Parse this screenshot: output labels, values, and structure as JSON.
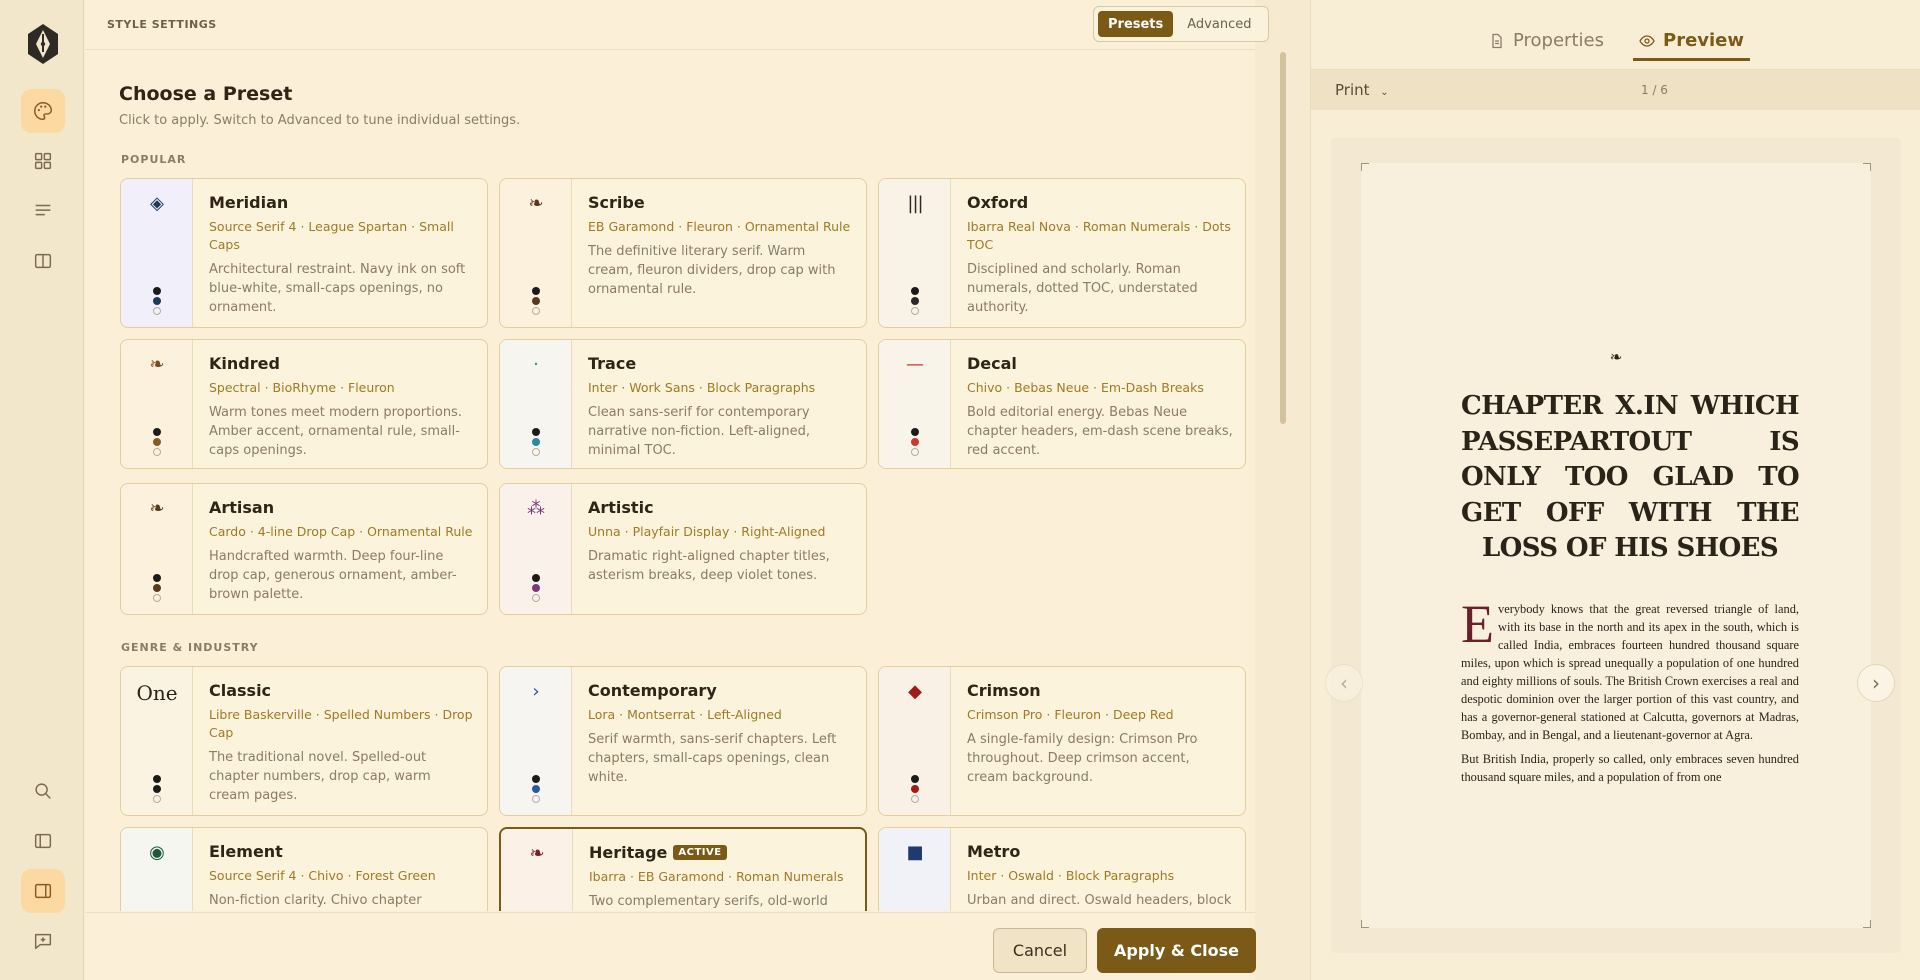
{
  "rail": {
    "items": [
      "logo",
      "palette",
      "grid",
      "lines",
      "book",
      "search",
      "panel-left",
      "panel-right",
      "comment-plus"
    ]
  },
  "header": {
    "title": "STYLE SETTINGS",
    "seg_presets": "Presets",
    "seg_advanced": "Advanced"
  },
  "main": {
    "heading": "Choose a Preset",
    "subheading": "Click to apply. Switch to Advanced to tune individual settings.",
    "section_popular": "POPULAR",
    "section_genre": "GENRE & INDUSTRY"
  },
  "cards": [
    {
      "name": "Meridian",
      "meta": "Source Serif 4 · League Spartan · Small Caps",
      "desc": "Architectural restraint. Navy ink on soft blue-white, small-caps openings, no ornament.",
      "glyph": "◈",
      "glyph_color": "#1e3a5f",
      "bg": "#f1effa",
      "dots": [
        "#1b1b1b",
        "#1e3a5f"
      ]
    },
    {
      "name": "Scribe",
      "meta": "EB Garamond · Fleuron · Ornamental Rule",
      "desc": "The definitive literary serif. Warm cream, fleuron dividers, drop cap with ornamental rule.",
      "glyph": "❧",
      "glyph_color": "#5a3a1e",
      "bg": "#fbf1dc",
      "dots": [
        "#1b1b1b",
        "#5a3a1e"
      ]
    },
    {
      "name": "Oxford",
      "meta": "Ibarra Real Nova · Roman Numerals · Dots TOC",
      "desc": "Disciplined and scholarly. Roman numerals, dotted TOC, understated authority.",
      "glyph": "|||",
      "glyph_color": "#2a2a2a",
      "bg": "#f8f3e6",
      "dots": [
        "#1b1b1b",
        "#2a2a2a"
      ]
    },
    {
      "name": "Kindred",
      "meta": "Spectral · BioRhyme · Fleuron",
      "desc": "Warm tones meet modern proportions. Amber accent, ornamental rule, small-caps openings.",
      "glyph": "❧",
      "glyph_color": "#7a4a1e",
      "bg": "#fbf1dc",
      "dots": [
        "#1b1b1b",
        "#8a5a22"
      ]
    },
    {
      "name": "Trace",
      "meta": "Inter · Work Sans · Block Paragraphs",
      "desc": "Clean sans-serif for contemporary narrative non-fiction. Left-aligned, minimal TOC.",
      "glyph": "·",
      "glyph_color": "#2a8a9a",
      "bg": "#f7f5ef",
      "dots": [
        "#1b1b1b",
        "#2a8a9a"
      ]
    },
    {
      "name": "Decal",
      "meta": "Chivo · Bebas Neue · Em-Dash Breaks",
      "desc": "Bold editorial energy. Bebas Neue chapter headers, em-dash scene breaks, red accent.",
      "glyph": "—",
      "glyph_color": "#c83a2a",
      "bg": "#f9f4ea",
      "dots": [
        "#1b1b1b",
        "#c83a2a"
      ]
    },
    {
      "name": "Artisan",
      "meta": "Cardo · 4-line Drop Cap · Ornamental Rule",
      "desc": "Handcrafted warmth. Deep four-line drop cap, generous ornament, amber-brown palette.",
      "glyph": "❧",
      "glyph_color": "#5a3a1e",
      "bg": "#fbf1dc",
      "dots": [
        "#1b1b1b",
        "#5a3a1e"
      ]
    },
    {
      "name": "Artistic",
      "meta": "Unna · Playfair Display · Right-Aligned",
      "desc": "Dramatic right-aligned chapter titles, asterism breaks, deep violet tones.",
      "glyph": "⁂",
      "glyph_color": "#7a3a7a",
      "bg": "#faf2ea",
      "dots": [
        "#1b1b1b",
        "#7a3a7a"
      ]
    },
    {
      "name": "Classic",
      "meta": "Libre Baskerville · Spelled Numbers · Drop Cap",
      "desc": "The traditional novel. Spelled-out chapter numbers, drop cap, warm cream pages.",
      "glyph": "One",
      "glyph_color": "#2a2418",
      "bg": "#fbf3e2",
      "dots": [
        "#1b1b1b",
        "#1b1b1b"
      ]
    },
    {
      "name": "Contemporary",
      "meta": "Lora · Montserrat · Left-Aligned",
      "desc": "Serif warmth, sans-serif chapters. Left chapters, small-caps openings, clean white.",
      "glyph": "›",
      "glyph_color": "#2a5a9a",
      "bg": "#f7f5f1",
      "dots": [
        "#1b1b1b",
        "#2a5a9a"
      ]
    },
    {
      "name": "Crimson",
      "meta": "Crimson Pro · Fleuron · Deep Red",
      "desc": "A single-family design: Crimson Pro throughout. Deep crimson accent, cream background.",
      "glyph": "◆",
      "glyph_color": "#a01a1a",
      "bg": "#faf1e6",
      "dots": [
        "#1b1b1b",
        "#a01a1a"
      ]
    },
    {
      "name": "Element",
      "meta": "Source Serif 4 · Chivo · Forest Green",
      "desc": "Non-fiction clarity. Chivo chapter",
      "glyph": "◉",
      "glyph_color": "#1e5a3a",
      "bg": "#f4f6ef",
      "dots": []
    },
    {
      "name": "Heritage",
      "badge": "ACTIVE",
      "meta": "Ibarra · EB Garamond · Roman Numerals",
      "desc": "Two complementary serifs, old-world",
      "glyph": "❧",
      "glyph_color": "#7a1e2a",
      "bg": "#fbf1e6",
      "dots": []
    },
    {
      "name": "Metro",
      "meta": "Inter · Oswald · Block Paragraphs",
      "desc": "Urban and direct. Oswald headers, block",
      "glyph": "■",
      "glyph_color": "#1e3a6f",
      "bg": "#f1f2f7",
      "dots": []
    }
  ],
  "footer": {
    "cancel": "Cancel",
    "apply": "Apply & Close"
  },
  "right": {
    "tab_properties": "Properties",
    "tab_preview": "Preview",
    "print_label": "Print",
    "page_indicator": "1 / 6",
    "ornament": "❧",
    "chapter_title": "CHAPTER X.IN WHICH PASSEPARTOUT IS ONLY TOO GLAD TO GET OFF WITH THE LOSS OF HIS SHOES",
    "drop_cap": "E",
    "para1": "verybody knows that the great reversed triangle of land, with its base in the north and its apex in the south, which is called India, embraces fourteen hundred thousand square miles, upon which is spread unequally a population of one hundred and eighty millions of souls. The British Crown exercises a real and despotic dominion over the larger portion of this vast country, and has a governor-general stationed at Calcutta, governors at Madras, Bombay, and in Bengal, and a lieutenant-governor at Agra.",
    "para2": "But British India, properly so called, only embraces seven hundred thousand square miles, and a population of from one"
  }
}
